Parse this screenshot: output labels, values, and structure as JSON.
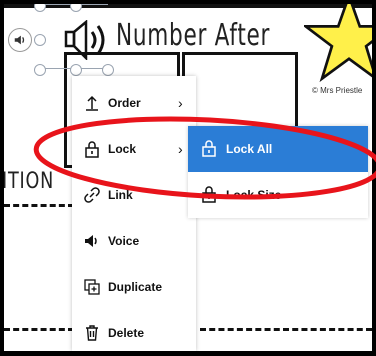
{
  "worksheet": {
    "headline": "Number After",
    "credit": "© Mrs Priestle",
    "side_word": "ITION"
  },
  "context_menu": {
    "items": [
      {
        "label": "Order",
        "icon": "order-icon",
        "has_submenu": true
      },
      {
        "label": "Lock",
        "icon": "lock-icon",
        "has_submenu": true
      },
      {
        "label": "Link",
        "icon": "link-icon",
        "has_submenu": false
      },
      {
        "label": "Voice",
        "icon": "speaker-icon",
        "has_submenu": false
      },
      {
        "label": "Duplicate",
        "icon": "duplicate-icon",
        "has_submenu": false
      },
      {
        "label": "Delete",
        "icon": "trash-icon",
        "has_submenu": false
      }
    ]
  },
  "lock_submenu": {
    "items": [
      {
        "label": "Lock All",
        "icon": "lock-icon",
        "selected": true
      },
      {
        "label": "Lock Size",
        "icon": "lock-icon",
        "selected": false
      }
    ]
  },
  "colors": {
    "selection_blue": "#2b7dd6",
    "star_yellow": "#fff04a",
    "annotation_red": "#e8141b"
  }
}
